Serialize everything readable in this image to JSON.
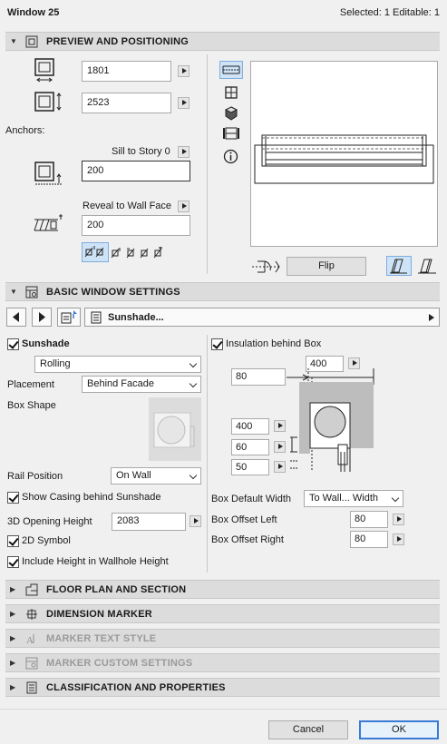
{
  "window": {
    "title": "Window 25",
    "selection_info": "Selected: 1 Editable: 1"
  },
  "sections": {
    "preview": "PREVIEW AND POSITIONING",
    "basic": "BASIC WINDOW SETTINGS",
    "floor_plan": "FLOOR PLAN AND SECTION",
    "dimension_marker": "DIMENSION MARKER",
    "marker_text": "MARKER TEXT STYLE",
    "marker_custom": "MARKER CUSTOM SETTINGS",
    "classification": "CLASSIFICATION AND PROPERTIES"
  },
  "preview": {
    "width_value": "1801",
    "height_value": "2523",
    "anchors_label": "Anchors:",
    "sill_label": "Sill to Story 0",
    "sill_value": "200",
    "reveal_label": "Reveal to Wall Face",
    "reveal_value": "200",
    "flip_label": "Flip"
  },
  "basic": {
    "library_part": "Sunshade...",
    "sunshade_label": "Sunshade",
    "sunshade_type": "Rolling",
    "placement_label": "Placement",
    "placement_value": "Behind Facade",
    "box_shape_label": "Box Shape",
    "rail_position_label": "Rail Position",
    "rail_position_value": "On Wall",
    "show_casing_label": "Show Casing behind Sunshade",
    "opening_height_label": "3D Opening Height",
    "opening_height_value": "2083",
    "symbol_2d_label": "2D Symbol",
    "include_height_label": "Include Height in Wallhole Height",
    "insulation_label": "Insulation behind Box",
    "dim_top": "400",
    "dim_left": "80",
    "dim_400": "400",
    "dim_60": "60",
    "dim_50": "50",
    "box_default_width_label": "Box Default Width",
    "box_default_width_value": "To Wall... Width",
    "box_offset_left_label": "Box Offset Left",
    "box_offset_left_value": "80",
    "box_offset_right_label": "Box Offset Right",
    "box_offset_right_value": "80"
  },
  "footer": {
    "cancel": "Cancel",
    "ok": "OK"
  },
  "colors": {
    "accent": "#3a7bd5",
    "header_bg": "#dcdcdc",
    "selected_icon_bg": "#cfe3f7"
  }
}
